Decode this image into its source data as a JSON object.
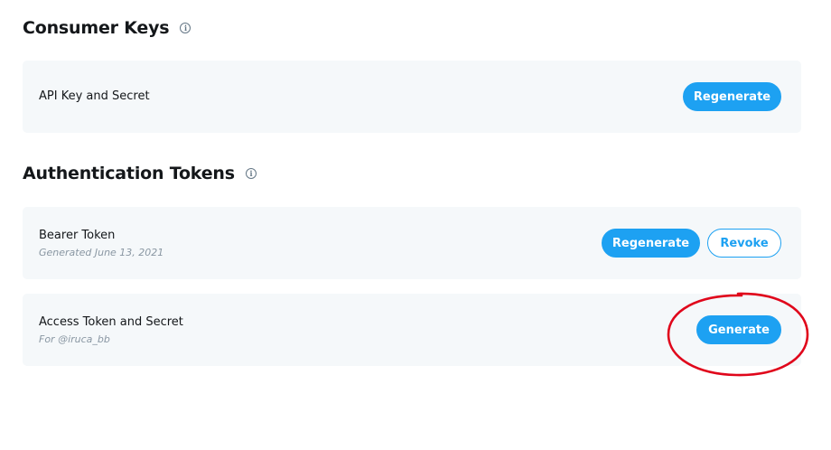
{
  "consumer_keys": {
    "title": "Consumer Keys",
    "info_glyph": "i",
    "api_key": {
      "label": "API Key and Secret",
      "regenerate_label": "Regenerate"
    }
  },
  "auth_tokens": {
    "title": "Authentication Tokens",
    "info_glyph": "i",
    "bearer": {
      "label": "Bearer Token",
      "sub": "Generated June 13, 2021",
      "regenerate_label": "Regenerate",
      "revoke_label": "Revoke"
    },
    "access": {
      "label": "Access Token and Secret",
      "sub": "For @iruca_bb",
      "generate_label": "Generate"
    }
  },
  "colors": {
    "accent": "#1da1f2",
    "card_bg": "#f5f8fa",
    "annotation": "#e0061b"
  },
  "icons": {
    "info": "info-circle-icon"
  }
}
